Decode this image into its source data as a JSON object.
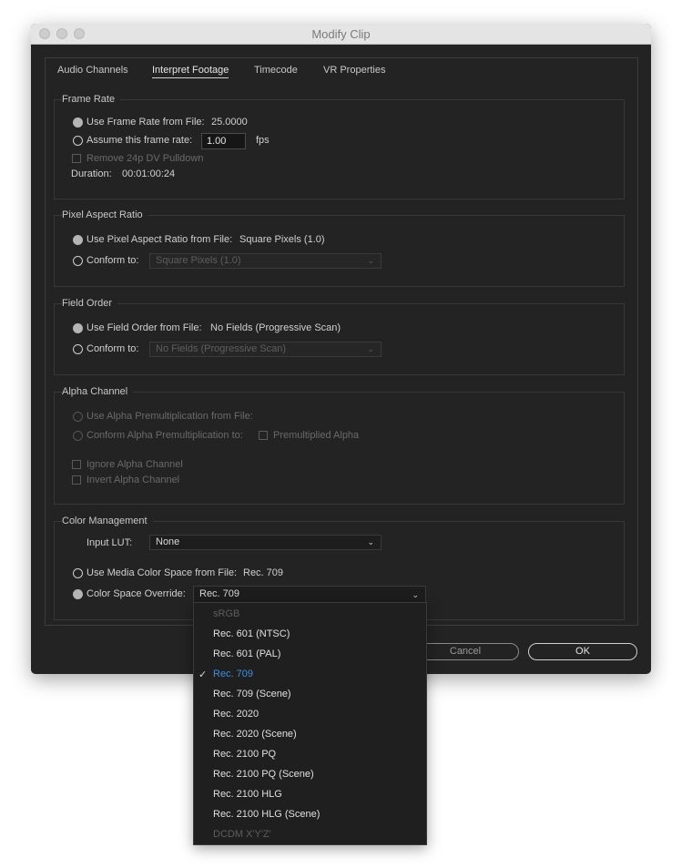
{
  "window": {
    "title": "Modify Clip"
  },
  "tabs": [
    "Audio Channels",
    "Interpret Footage",
    "Timecode",
    "VR Properties"
  ],
  "frame_rate": {
    "label": "Frame Rate",
    "use_from_file": "Use Frame Rate from File:",
    "file_value": "25.0000",
    "assume": "Assume this frame rate:",
    "assume_value": "1.00",
    "unit": "fps",
    "pulldown": "Remove 24p DV Pulldown",
    "duration_label": "Duration:",
    "duration_value": "00:01:00:24"
  },
  "pixel_aspect": {
    "label": "Pixel Aspect Ratio",
    "use_from_file": "Use Pixel Aspect Ratio from File:",
    "file_value": "Square Pixels (1.0)",
    "conform": "Conform to:",
    "conform_value": "Square Pixels (1.0)"
  },
  "field_order": {
    "label": "Field Order",
    "use_from_file": "Use Field Order from File:",
    "file_value": "No Fields (Progressive Scan)",
    "conform": "Conform to:",
    "conform_value": "No Fields (Progressive Scan)"
  },
  "alpha": {
    "label": "Alpha Channel",
    "use_from_file": "Use Alpha Premultiplication from File:",
    "conform": "Conform Alpha Premultiplication to:",
    "premultiplied": "Premultiplied Alpha",
    "ignore": "Ignore Alpha Channel",
    "invert": "Invert Alpha Channel"
  },
  "color": {
    "label": "Color Management",
    "input_lut_label": "Input LUT:",
    "input_lut_value": "None",
    "use_media": "Use Media Color Space from File:",
    "media_value": "Rec. 709",
    "override": "Color Space Override:",
    "override_value": "Rec. 709"
  },
  "dropdown": {
    "items": [
      "sRGB",
      "Rec. 601 (NTSC)",
      "Rec. 601 (PAL)",
      "Rec. 709",
      "Rec. 709 (Scene)",
      "Rec. 2020",
      "Rec. 2020 (Scene)",
      "Rec. 2100 PQ",
      "Rec. 2100 PQ (Scene)",
      "Rec. 2100 HLG",
      "Rec. 2100 HLG (Scene)",
      "DCDM X'Y'Z'"
    ],
    "selected": "Rec. 709",
    "selected_color": "#3d8ee6"
  },
  "buttons": {
    "cancel": "Cancel",
    "ok": "OK"
  }
}
